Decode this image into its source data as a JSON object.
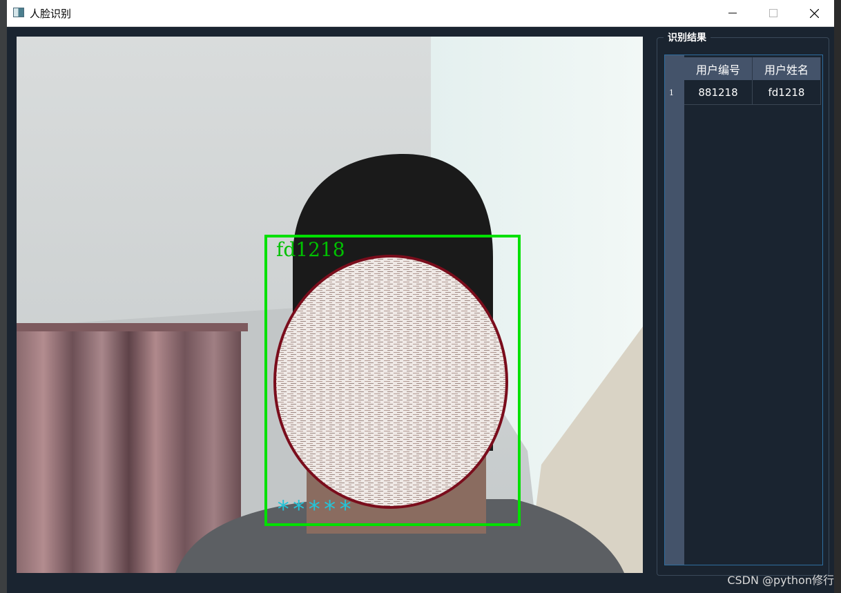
{
  "window": {
    "title": "人脸识别",
    "controls": {
      "minimize": "minimize-icon",
      "maximize": "maximize-icon",
      "close": "close-icon"
    }
  },
  "camera": {
    "detected_name": "fd1218",
    "password_mask": "*****",
    "colors": {
      "box": "#00e000",
      "mask_outline": "#7a0d1c",
      "mask_text": "#23c4d8"
    }
  },
  "results": {
    "group_title": "识别结果",
    "columns": [
      "用户编号",
      "用户姓名"
    ],
    "rows": [
      {
        "index": "1",
        "user_id": "881218",
        "user_name": "fd1218"
      }
    ]
  },
  "watermark": "CSDN @python修行"
}
